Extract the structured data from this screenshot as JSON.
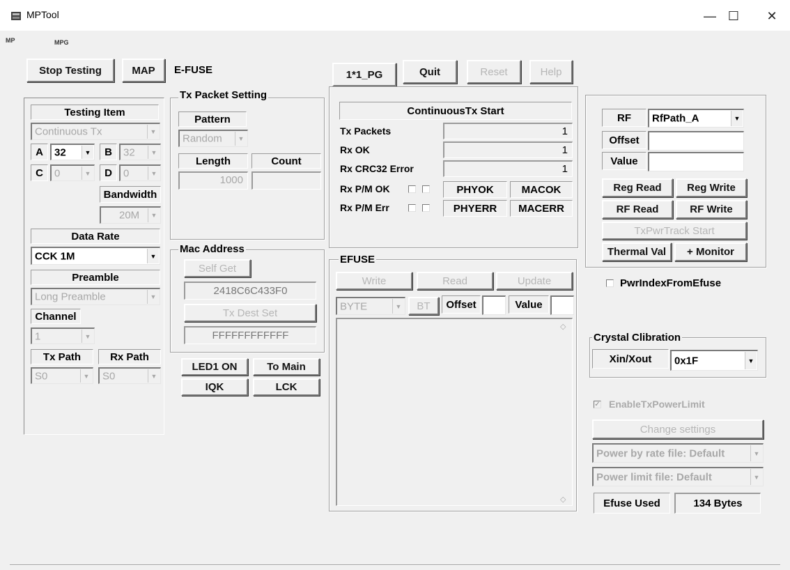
{
  "window": {
    "title": "MPTool",
    "minimize": "—",
    "maximize": "☐",
    "close": "✕"
  },
  "menu": {
    "mp": "MP",
    "mpg": "MPG"
  },
  "top_buttons": {
    "stop_testing": "Stop Testing",
    "map": "MAP",
    "efuse_tab": "E-FUSE",
    "pg": "1*1_PG",
    "quit": "Quit",
    "reset": "Reset",
    "help": "Help"
  },
  "testing": {
    "testing_item_label": "Testing Item",
    "testing_item_value": "Continuous Tx",
    "a_label": "A",
    "a_value": "32",
    "b_label": "B",
    "b_value": "32",
    "c_label": "C",
    "c_value": "0",
    "d_label": "D",
    "d_value": "0",
    "bandwidth_label": "Bandwidth",
    "bandwidth_value": "20M",
    "data_rate_label": "Data Rate",
    "data_rate_value": "CCK 1M",
    "preamble_label": "Preamble",
    "preamble_value": "Long Preamble",
    "channel_label": "Channel",
    "channel_value": "1",
    "tx_path_label": "Tx Path",
    "tx_path_value": "S0",
    "rx_path_label": "Rx Path",
    "rx_path_value": "S0"
  },
  "tx_packet": {
    "title": "Tx Packet Setting",
    "pattern_label": "Pattern",
    "pattern_value": "Random",
    "length_label": "Length",
    "length_value": "1000",
    "count_label": "Count",
    "count_value": ""
  },
  "mac": {
    "title": "Mac Address",
    "self_get": "Self Get",
    "address": "2418C6C433F0",
    "tx_dest_set": "Tx Dest Set",
    "dest": "FFFFFFFFFFFF"
  },
  "bottom_buttons": {
    "led1_on": "LED1 ON",
    "to_main": "To Main",
    "iqk": "IQK",
    "lck": "LCK"
  },
  "stats": {
    "header": "ContinuousTx Start",
    "tx_packets_label": "Tx Packets",
    "tx_packets_value": "1",
    "rx_ok_label": "Rx OK",
    "rx_ok_value": "1",
    "rx_crc_label": "Rx CRC32 Error",
    "rx_crc_value": "1",
    "rx_pm_ok_label": "Rx P/M OK",
    "phyok": "PHYOK",
    "macok": "MACOK",
    "rx_pm_err_label": "Rx P/M Err",
    "phyerr": "PHYERR",
    "macerr": "MACERR"
  },
  "efuse": {
    "title": "EFUSE",
    "write": "Write",
    "read": "Read",
    "update": "Update",
    "byte_value": "BYTE",
    "bt": "BT",
    "offset_label": "Offset",
    "value_label": "Value",
    "scroll_up": "◇",
    "scroll_down": "◇"
  },
  "rf": {
    "rf_label": "RF",
    "rf_path_value": "RfPath_A",
    "offset_label": "Offset",
    "value_label": "Value",
    "reg_read": "Reg Read",
    "reg_write": "Reg Write",
    "rf_read": "RF Read",
    "rf_write": "RF Write",
    "txpwr_track": "TxPwrTrack Start",
    "thermal_val": "Thermal Val",
    "monitor": "+ Monitor"
  },
  "pwr_index_from_efuse": "PwrIndexFromEfuse",
  "crystal": {
    "title": "Crystal Clibration",
    "xin_xout": "Xin/Xout",
    "value": "0x1F"
  },
  "txpower": {
    "enable_label": "EnableTxPowerLimit",
    "check_mark": "✓",
    "change_settings": "Change settings",
    "power_by_rate": "Power by rate file: Default",
    "power_limit": "Power limit file: Default"
  },
  "efuse_used": {
    "label": "Efuse Used",
    "value": "134 Bytes"
  }
}
